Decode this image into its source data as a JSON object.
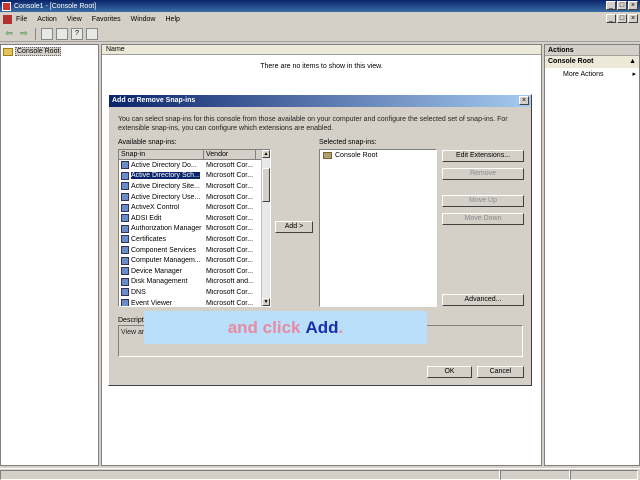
{
  "window": {
    "title": "Console1 - [Console Root]",
    "min": "_",
    "max": "□",
    "close": "×"
  },
  "menu": [
    "File",
    "Action",
    "View",
    "Favorites",
    "Window",
    "Help"
  ],
  "mdi_buttons": {
    "min": "_",
    "max": "□",
    "close": "×"
  },
  "toolbar": {
    "back": "⇦",
    "forward": "⇨"
  },
  "tree": {
    "root": "Console Root"
  },
  "center": {
    "column_name": "Name",
    "empty_message": "There are no items to show in this view."
  },
  "actions": {
    "header": "Actions",
    "section": "Console Root",
    "section_arrow": "▲",
    "more": "More Actions",
    "more_arrow": "▸"
  },
  "dialog": {
    "title": "Add or Remove Snap-ins",
    "close": "×",
    "intro": "You can select snap-ins for this console from those available on your computer and configure the selected set of snap-ins. For extensible snap-ins, you can configure which extensions are enabled.",
    "available_label": "Available snap-ins:",
    "selected_label": "Selected snap-ins:",
    "columns": {
      "snapin": "Snap-in",
      "vendor": "Vendor"
    },
    "snapins": [
      {
        "name": "Active Directory Do...",
        "vendor": "Microsoft Cor..."
      },
      {
        "name": "Active Directory Sch...",
        "vendor": "Microsoft Cor..."
      },
      {
        "name": "Active Directory Site...",
        "vendor": "Microsoft Cor..."
      },
      {
        "name": "Active Directory Use...",
        "vendor": "Microsoft Cor..."
      },
      {
        "name": "ActiveX Control",
        "vendor": "Microsoft Cor..."
      },
      {
        "name": "ADSI Edit",
        "vendor": "Microsoft Cor..."
      },
      {
        "name": "Authorization Manager",
        "vendor": "Microsoft Cor..."
      },
      {
        "name": "Certificates",
        "vendor": "Microsoft Cor..."
      },
      {
        "name": "Component Services",
        "vendor": "Microsoft Cor..."
      },
      {
        "name": "Computer Managem...",
        "vendor": "Microsoft Cor..."
      },
      {
        "name": "Device Manager",
        "vendor": "Microsoft Cor..."
      },
      {
        "name": "Disk Management",
        "vendor": "Microsoft and..."
      },
      {
        "name": "DNS",
        "vendor": "Microsoft Cor..."
      },
      {
        "name": "Event Viewer",
        "vendor": "Microsoft Cor..."
      }
    ],
    "selected_root": "Console Root",
    "buttons": {
      "add": "Add >",
      "edit_extensions": "Edit Extensions...",
      "remove": "Remove",
      "move_up": "Move Up",
      "move_down": "Move Down",
      "advanced": "Advanced...",
      "ok": "OK",
      "cancel": "Cancel"
    },
    "description_label": "Description:",
    "description": "View an"
  },
  "caption": {
    "part1": "and click",
    "part2": "Add",
    "part3": "."
  }
}
